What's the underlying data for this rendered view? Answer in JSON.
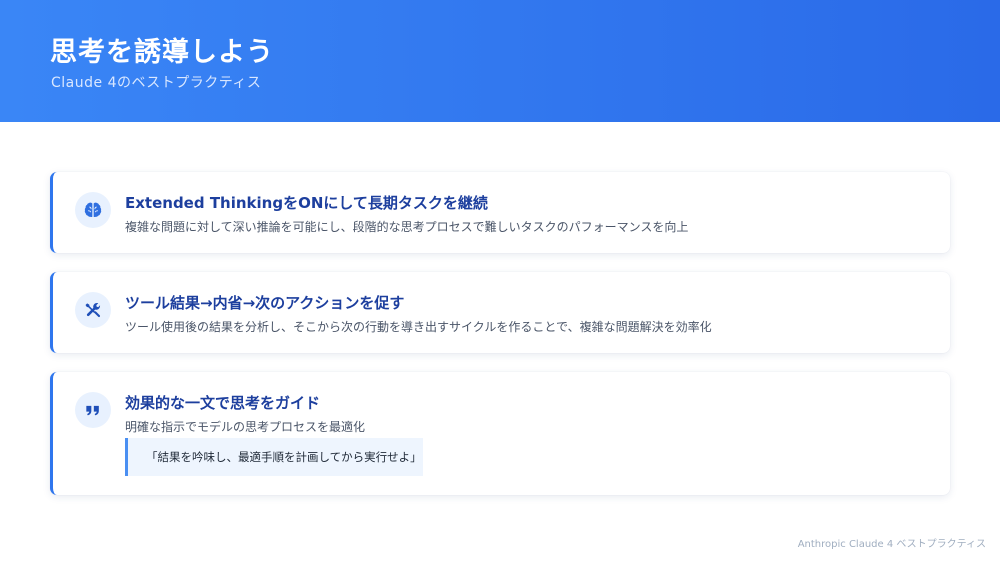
{
  "header": {
    "title": "思考を誘導しよう",
    "subtitle": "Claude 4のベストプラクティス"
  },
  "cards": [
    {
      "icon": "brain-icon",
      "title": "Extended ThinkingをONにして長期タスクを継続",
      "description": "複雑な問題に対して深い推論を可能にし、段階的な思考プロセスで難しいタスクのパフォーマンスを向上"
    },
    {
      "icon": "tools-icon",
      "title": "ツール結果→内省→次のアクションを促す",
      "description": "ツール使用後の結果を分析し、そこから次の行動を導き出すサイクルを作ることで、複雑な問題解決を効率化"
    },
    {
      "icon": "quote-icon",
      "title": "効果的な一文で思考をガイド",
      "description": "明確な指示でモデルの思考プロセスを最適化",
      "quote": "「結果を吟味し、最適手順を計画してから実行せよ」"
    }
  ],
  "footer": {
    "text": "Anthropic Claude 4 ベストプラクティス"
  },
  "colors": {
    "header_gradient_start": "#3a86f6",
    "header_gradient_end": "#2a6ae8",
    "accent": "#2f76ee",
    "card_title": "#1d3f9e",
    "icon_bg": "#e8f1fe",
    "quote_bg": "#eef5fe"
  }
}
